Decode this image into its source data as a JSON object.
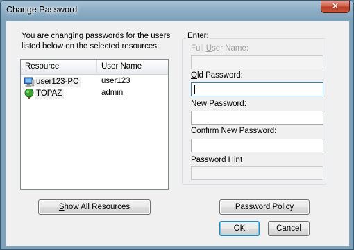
{
  "window": {
    "title": "Change Password",
    "close_glyph": "✕"
  },
  "intro_text": "You are changing passwords for the users listed below on the selected resources:",
  "list": {
    "columns": [
      "Resource",
      "User Name"
    ],
    "rows": [
      {
        "resource": "user123-PC",
        "user": "user123",
        "icon": "computer-icon"
      },
      {
        "resource": "TOPAZ",
        "user": "admin",
        "icon": "tree-icon"
      }
    ]
  },
  "enter_group": {
    "title": "Enter:",
    "full_user_name": {
      "label_pre": "Full ",
      "label_key": "U",
      "label_post": "ser Name:",
      "value": ""
    },
    "old_password": {
      "label_pre": "",
      "label_key": "O",
      "label_post": "ld Password:",
      "value": ""
    },
    "new_password": {
      "label_pre": "",
      "label_key": "N",
      "label_post": "ew Password:",
      "value": ""
    },
    "confirm_password": {
      "label_pre": "Co",
      "label_key": "n",
      "label_post": "firm New Password:",
      "value": ""
    },
    "password_hint": {
      "label": "Password Hint",
      "value": ""
    }
  },
  "buttons": {
    "show_all_pre": "",
    "show_all_key": "S",
    "show_all_post": "how All Resources",
    "password_policy": "Password Policy",
    "ok": "OK",
    "cancel": "Cancel"
  }
}
